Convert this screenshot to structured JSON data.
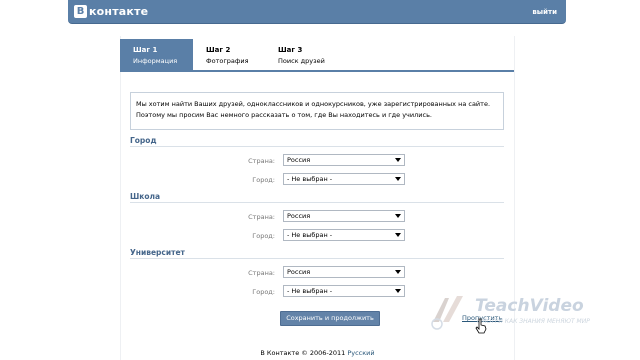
{
  "header": {
    "logo_letter": "В",
    "logo_text": "контакте",
    "logout_label": "выйти"
  },
  "steps": [
    {
      "title": "Шаг 1",
      "label": "Информация"
    },
    {
      "title": "Шаг 2",
      "label": "Фотография"
    },
    {
      "title": "Шаг 3",
      "label": "Поиск друзей"
    }
  ],
  "info": {
    "line1": "Мы хотим найти Ваших друзей, одноклассников и однокурсников, уже зарегистрированных на сайте.",
    "line2": "Поэтому мы просим Вас немного рассказать о том, где Вы находитесь и где учились."
  },
  "sections": {
    "city": {
      "title": "Город",
      "country_label": "Страна:",
      "country_value": "Россия",
      "city_label": "Город:",
      "city_value": "- Не выбран -"
    },
    "school": {
      "title": "Школа",
      "country_label": "Страна:",
      "country_value": "Россия",
      "city_label": "Город:",
      "city_value": "- Не выбран -"
    },
    "university": {
      "title": "Университет",
      "country_label": "Страна:",
      "country_value": "Россия",
      "city_label": "Город:",
      "city_value": "- Не выбран -"
    }
  },
  "actions": {
    "submit_label": "Сохранить и продолжить",
    "skip_label": "Пропустить"
  },
  "footer": {
    "copyright": "В Контакте © 2006-2011",
    "language": "Русский"
  },
  "watermark": {
    "brand": "TeachVideo",
    "tagline": "СМОТРИ КАК ЗНАНИЯ МЕНЯЮТ МИР"
  },
  "colors": {
    "accent": "#5a7fa7",
    "section_title": "#44658a",
    "link": "#2b587a"
  }
}
